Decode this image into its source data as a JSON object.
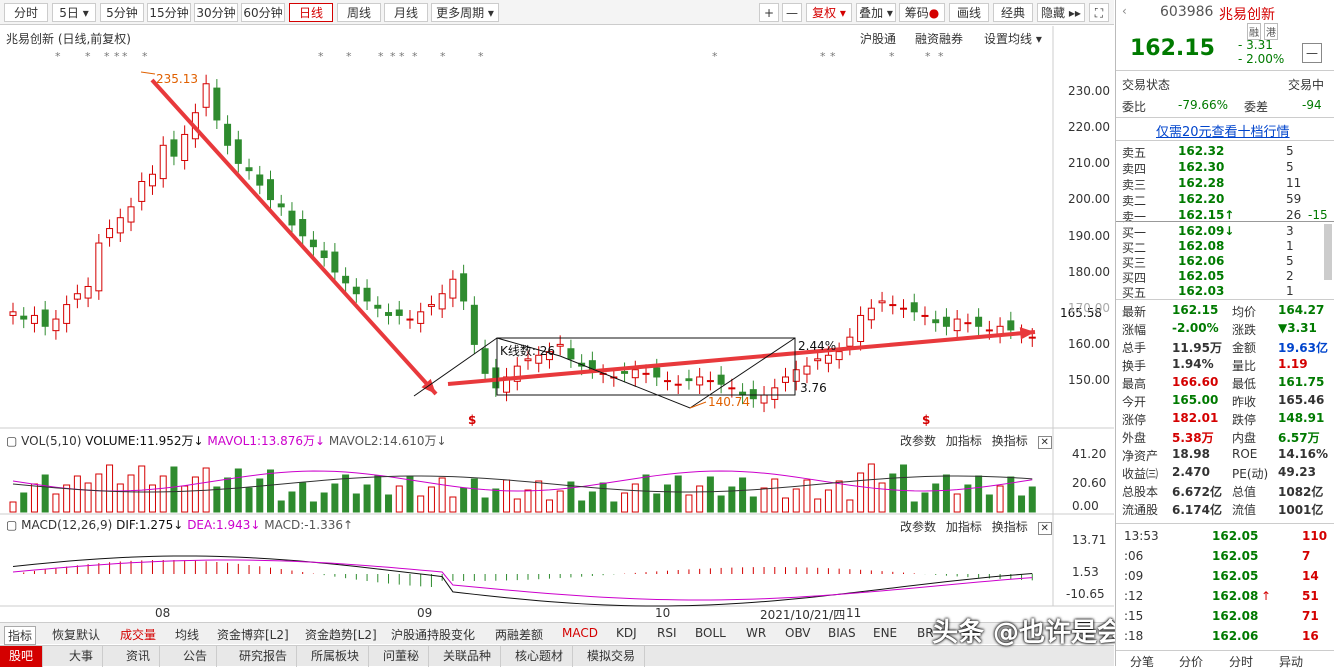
{
  "toolbar": {
    "periods": [
      "分时",
      "5日",
      "5分钟",
      "15分钟",
      "30分钟",
      "60分钟",
      "日线",
      "周线",
      "月线",
      "更多周期"
    ],
    "selected": "日线",
    "plus": "+",
    "minus": "—",
    "fuquan": "复权",
    "tools": [
      "叠加",
      "筹码",
      "画线",
      "经典",
      "隐藏"
    ]
  },
  "chart": {
    "title": "兆易创新 (日线,前复权)",
    "links": [
      "沪股通",
      "融资融券",
      "设置均线"
    ],
    "high_label": "235.13",
    "low_label": "140.74",
    "box_label": "K线数: 26",
    "pct_label": "2.44%",
    "diff_label": "3.76",
    "price_now": "165.58",
    "xaxis": [
      "08",
      "09",
      "10",
      "2021/10/21/四",
      "11"
    ],
    "yticks_price": [
      "230.00",
      "220.00",
      "210.00",
      "200.00",
      "190.00",
      "180.00",
      "170.00",
      "160.00",
      "150.00"
    ],
    "markers": [
      "$",
      "$"
    ],
    "colors": {
      "up": "#d40000",
      "down": "#2e8b2e",
      "arrow": "#e8393c",
      "ma1": "#cc00cc",
      "ma2": "#333333"
    }
  },
  "volume": {
    "label": "VOL(5,10)",
    "volume": "VOLUME:11.952万",
    "mavol1": "MAVOL1:13.876万",
    "mavol2": "MAVOL2:14.610万",
    "yticks": [
      "41.20",
      "20.60",
      "0.00"
    ],
    "actions": [
      "改参数",
      "加指标",
      "换指标"
    ]
  },
  "macd": {
    "label": "MACD(12,26,9)",
    "dif": "DIF:1.275",
    "dea": "DEA:1.943",
    "macd": "MACD:-1.336",
    "yticks": [
      "13.71",
      "1.53",
      "-10.65"
    ],
    "actions": [
      "改参数",
      "加指标",
      "换指标"
    ]
  },
  "indicator_tabs": [
    "指标",
    "恢复默认",
    "成交量",
    "均线",
    "资金博弈[L2]",
    "资金趋势[L2]",
    "沪股通持股变化",
    "两融差额",
    "MACD",
    "KDJ",
    "RSI",
    "BOLL",
    "WR",
    "OBV",
    "BIAS",
    "ENE",
    "BR"
  ],
  "bottom_tabs": [
    "股吧",
    "大事",
    "资讯",
    "公告",
    "研究报告",
    "所属板块",
    "问董秘",
    "关联品种",
    "核心题材",
    "模拟交易"
  ],
  "watermark": "头条 @也许是会飞的小牛",
  "quote": {
    "code": "603986",
    "name": "兆易创新",
    "badges": [
      "融",
      "港"
    ],
    "price": "162.15",
    "change": "- 3.31",
    "change_pct": "- 2.00%",
    "status_label": "交易状态",
    "status": "交易中",
    "weibi_label": "委比",
    "weibi": "-79.66%",
    "weicha_label": "委差",
    "weicha": "-94",
    "promo": "仅需20元查看十档行情",
    "asks": [
      {
        "label": "卖五",
        "price": "162.32",
        "vol": "5",
        "chg": ""
      },
      {
        "label": "卖四",
        "price": "162.30",
        "vol": "5",
        "chg": ""
      },
      {
        "label": "卖三",
        "price": "162.28",
        "vol": "11",
        "chg": ""
      },
      {
        "label": "卖二",
        "price": "162.20",
        "vol": "59",
        "chg": ""
      },
      {
        "label": "卖一",
        "price": "162.15↑",
        "vol": "26",
        "chg": "-15"
      }
    ],
    "bids": [
      {
        "label": "买一",
        "price": "162.09↓",
        "vol": "3"
      },
      {
        "label": "买二",
        "price": "162.08",
        "vol": "1"
      },
      {
        "label": "买三",
        "price": "162.06",
        "vol": "5"
      },
      {
        "label": "买四",
        "price": "162.05",
        "vol": "2"
      },
      {
        "label": "买五",
        "price": "162.03",
        "vol": "1"
      }
    ],
    "stats": [
      {
        "l1": "最新",
        "v1": "162.15",
        "c1": "g",
        "l2": "均价",
        "v2": "164.27",
        "c2": "g"
      },
      {
        "l1": "涨幅",
        "v1": "-2.00%",
        "c1": "g",
        "l2": "涨跌",
        "v2": "▼3.31",
        "c2": "g"
      },
      {
        "l1": "总手",
        "v1": "11.95万",
        "c1": "k",
        "l2": "金额",
        "v2": "19.63亿",
        "c2": "b"
      },
      {
        "l1": "换手",
        "v1": "1.94%",
        "c1": "k",
        "l2": "量比",
        "v2": "1.19",
        "c2": "r"
      },
      {
        "l1": "最高",
        "v1": "166.60",
        "c1": "r",
        "l2": "最低",
        "v2": "161.75",
        "c2": "g"
      },
      {
        "l1": "今开",
        "v1": "165.00",
        "c1": "g",
        "l2": "昨收",
        "v2": "165.46",
        "c2": "k"
      },
      {
        "l1": "涨停",
        "v1": "182.01",
        "c1": "r",
        "l2": "跌停",
        "v2": "148.91",
        "c2": "g"
      },
      {
        "l1": "外盘",
        "v1": "5.38万",
        "c1": "r",
        "l2": "内盘",
        "v2": "6.57万",
        "c2": "g"
      },
      {
        "l1": "净资产",
        "v1": "18.98",
        "c1": "k",
        "l2": "ROE",
        "v2": "14.16%",
        "c2": "k"
      },
      {
        "l1": "收益㈢",
        "v1": "2.470",
        "c1": "k",
        "l2": "PE(动)",
        "v2": "49.23",
        "c2": "k"
      },
      {
        "l1": "总股本",
        "v1": "6.672亿",
        "c1": "k",
        "l2": "总值",
        "v2": "1082亿",
        "c2": "k"
      },
      {
        "l1": "流通股",
        "v1": "6.174亿",
        "c1": "k",
        "l2": "流值",
        "v2": "1001亿",
        "c2": "k"
      }
    ],
    "ticks": [
      {
        "t": "13:53",
        "p": "162.05",
        "v": "110",
        "arrow": ""
      },
      {
        "t": ":06",
        "p": "162.05",
        "v": "7",
        "arrow": ""
      },
      {
        "t": ":09",
        "p": "162.05",
        "v": "14",
        "arrow": ""
      },
      {
        "t": ":12",
        "p": "162.08",
        "v": "51",
        "arrow": "↑"
      },
      {
        "t": ":15",
        "p": "162.08",
        "v": "71",
        "arrow": ""
      },
      {
        "t": ":18",
        "p": "162.06",
        "v": "16",
        "arrow": ""
      }
    ],
    "tabs": [
      "分笔",
      "分价",
      "分时",
      "异动"
    ]
  }
}
